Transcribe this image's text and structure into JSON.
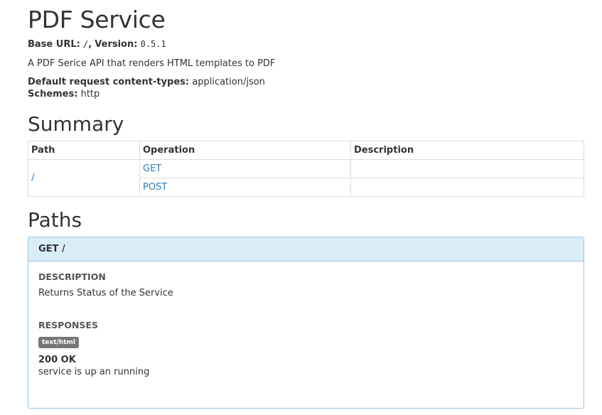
{
  "service": {
    "title": "PDF Service",
    "base_url_label": "Base URL:",
    "base_url": "/",
    "version_label": "Version:",
    "version": "0.5.1",
    "description": "A PDF Serice API that renders HTML templates to PDF",
    "content_types_label": "Default request content-types:",
    "content_types": "application/json",
    "schemes_label": "Schemes:",
    "schemes": "http"
  },
  "summary": {
    "heading": "Summary",
    "columns": [
      "Path",
      "Operation",
      "Description"
    ],
    "rows": [
      {
        "path": "/",
        "operation": "GET",
        "description": ""
      },
      {
        "path": "/",
        "operation": "POST",
        "description": ""
      }
    ]
  },
  "paths": {
    "heading": "Paths",
    "operations": [
      {
        "title": "GET /",
        "description_label": "DESCRIPTION",
        "description": "Returns Status of the Service",
        "responses_label": "RESPONSES",
        "content_type_badge": "text/html",
        "status": "200 OK",
        "status_description": "service is up an running"
      }
    ]
  },
  "colors": {
    "link": "#337ab7",
    "panel_header_bg": "#d9edf7",
    "panel_border": "#9cc2e0",
    "badge_bg": "#777777"
  }
}
